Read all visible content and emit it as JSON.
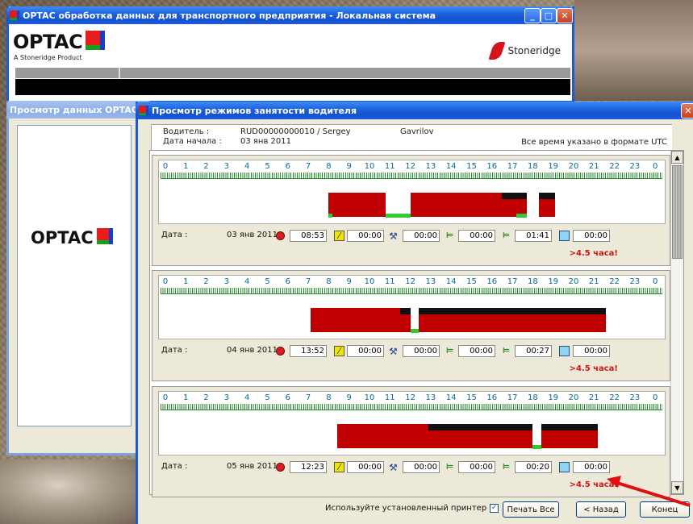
{
  "main_window": {
    "title": "OPTAC обработка данных для транспортного предприятия - Локальная система",
    "logo_text": "OPTAC",
    "logo_sub": "A Stoneridge Product",
    "stoneridge": "Stoneridge"
  },
  "data_window": {
    "title": "Просмотр данных OPTAC -",
    "logo_text": "OPTAC"
  },
  "driver_window": {
    "title": "Просмотр режимов занятости водителя",
    "driver_label": "Водитель :",
    "driver_value": "RUD00000000010 / Sergey",
    "driver_surname": "Gavrilov",
    "start_label": "Дата начала :",
    "start_value": "03 янв 2011",
    "utc_note": "Все время указано в формате UTC",
    "hours": [
      "0",
      "1",
      "2",
      "3",
      "4",
      "5",
      "6",
      "7",
      "8",
      "9",
      "10",
      "11",
      "12",
      "13",
      "14",
      "15",
      "16",
      "17",
      "18",
      "19",
      "20",
      "21",
      "22",
      "23",
      "0"
    ],
    "days": [
      {
        "date_label": "Дата :",
        "date": "03 янв 2011",
        "drive": "08:53",
        "work": "00:00",
        "other": "00:00",
        "rest1": "00:00",
        "rest2": "01:41",
        "available": "00:00",
        "warning": ">4.5 часа!"
      },
      {
        "date_label": "Дата :",
        "date": "04 янв 2011",
        "drive": "13:52",
        "work": "00:00",
        "other": "00:00",
        "rest1": "00:00",
        "rest2": "00:27",
        "available": "00:00",
        "warning": ">4.5 часа!"
      },
      {
        "date_label": "Дата :",
        "date": "05 янв 2011",
        "drive": "12:23",
        "work": "00:00",
        "other": "00:00",
        "rest1": "00:00",
        "rest2": "00:20",
        "available": "00:00",
        "warning": ">4.5 часа!"
      }
    ],
    "use_printer": "Используйте установленный принтер",
    "use_printer_checked": true,
    "print_all": "Печать Все",
    "back": "< Назад",
    "end": "Конец"
  },
  "colors": {
    "drive": "#c00000",
    "rest": "#2ecc2e",
    "black_bar": "#111111",
    "warn": "#d21414"
  },
  "icons": [
    "drive-icon",
    "work-icon",
    "tools-icon",
    "bed-icon",
    "double-bed-icon",
    "available-icon"
  ]
}
